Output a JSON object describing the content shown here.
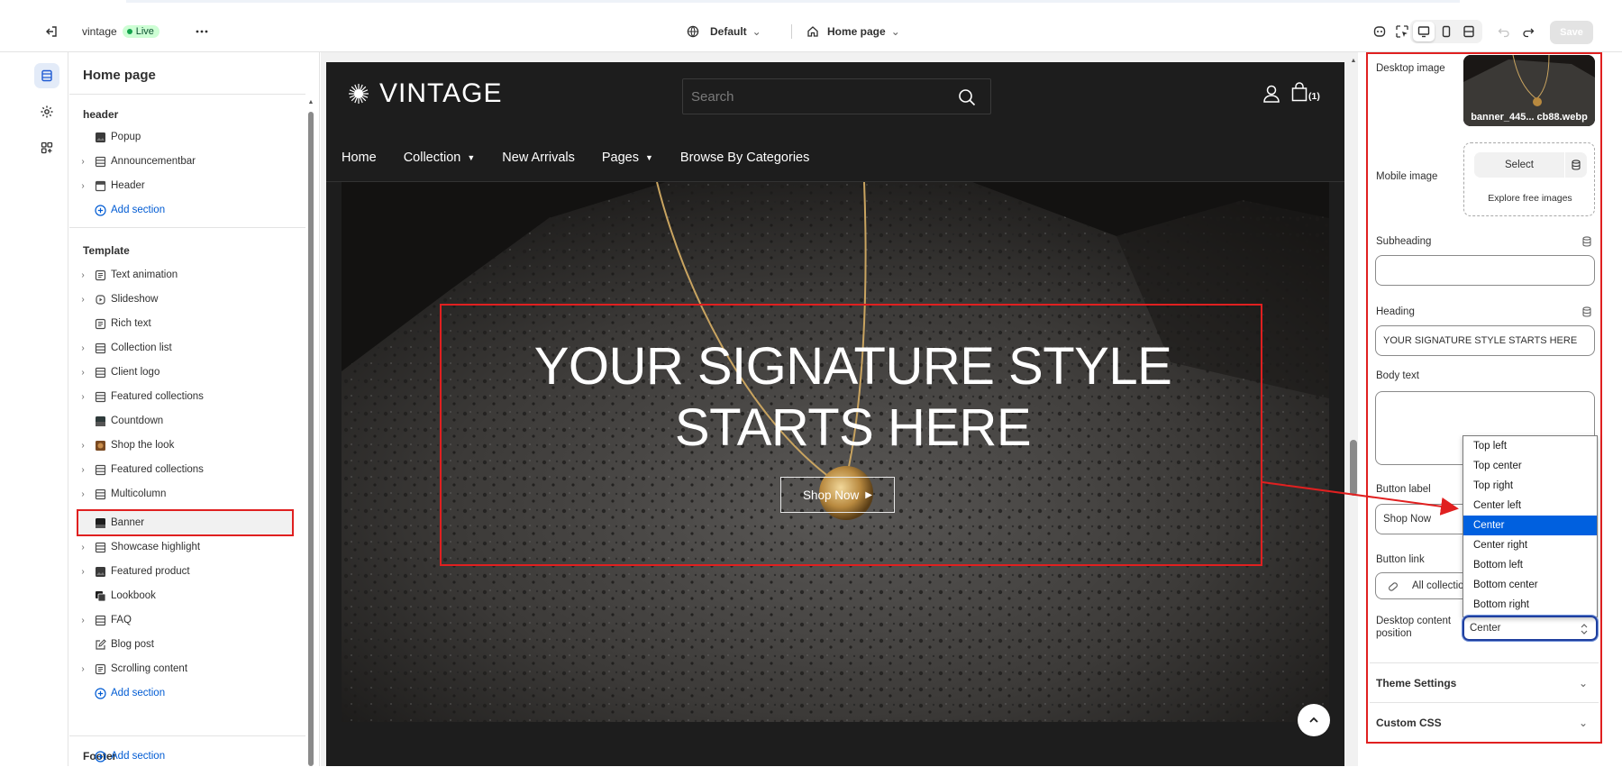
{
  "topbar": {
    "store_name": "vintage",
    "live_badge": "Live",
    "theme_label": "Default",
    "page_label": "Home page",
    "save_label": "Save"
  },
  "tree": {
    "title": "Home page",
    "groups": {
      "header": "header",
      "template": "Template",
      "footer": "Footer"
    },
    "header_items": [
      "Popup",
      "Announcementbar",
      "Header"
    ],
    "template_items": [
      "Text animation",
      "Slideshow",
      "Rich text",
      "Collection list",
      "Client logo",
      "Featured collections",
      "Countdown",
      "Shop the look",
      "Featured collections",
      "Multicolumn",
      "Banner",
      "Showcase highlight",
      "Featured product",
      "Lookbook",
      "FAQ",
      "Blog post",
      "Scrolling content"
    ],
    "add_section": "Add section"
  },
  "store": {
    "logo": "VINTAGE",
    "search_placeholder": "Search",
    "cart_count": "(1)",
    "nav": [
      "Home",
      "Collection",
      "New Arrivals",
      "Pages",
      "Browse By Categories"
    ],
    "hero_heading_line1": "YOUR SIGNATURE STYLE",
    "hero_heading_line2": "STARTS HERE",
    "hero_button": "Shop Now"
  },
  "settings": {
    "desktop_image_label": "Desktop image",
    "desktop_image_name": "banner_445... cb88.webp",
    "mobile_image_label": "Mobile image",
    "select_label": "Select",
    "explore_label": "Explore free images",
    "subheading_label": "Subheading",
    "subheading_value": "",
    "heading_label": "Heading",
    "heading_value": "YOUR SIGNATURE STYLE STARTS HERE",
    "body_label": "Body text",
    "button_label_label": "Button label",
    "button_label_value": "Shop Now",
    "button_link_label": "Button link",
    "button_link_value": "All collectio",
    "position_label_line1": "Desktop content",
    "position_label_line2": "position",
    "position_value": "Center",
    "position_options": [
      "Top left",
      "Top center",
      "Top right",
      "Center left",
      "Center",
      "Center right",
      "Bottom left",
      "Bottom center",
      "Bottom right"
    ],
    "theme_settings": "Theme Settings",
    "custom_css": "Custom CSS"
  },
  "colors": {
    "highlight": "#e02020",
    "link": "#005bd3",
    "selected_option": "#0060df",
    "live_badge": "#cdfed4"
  }
}
